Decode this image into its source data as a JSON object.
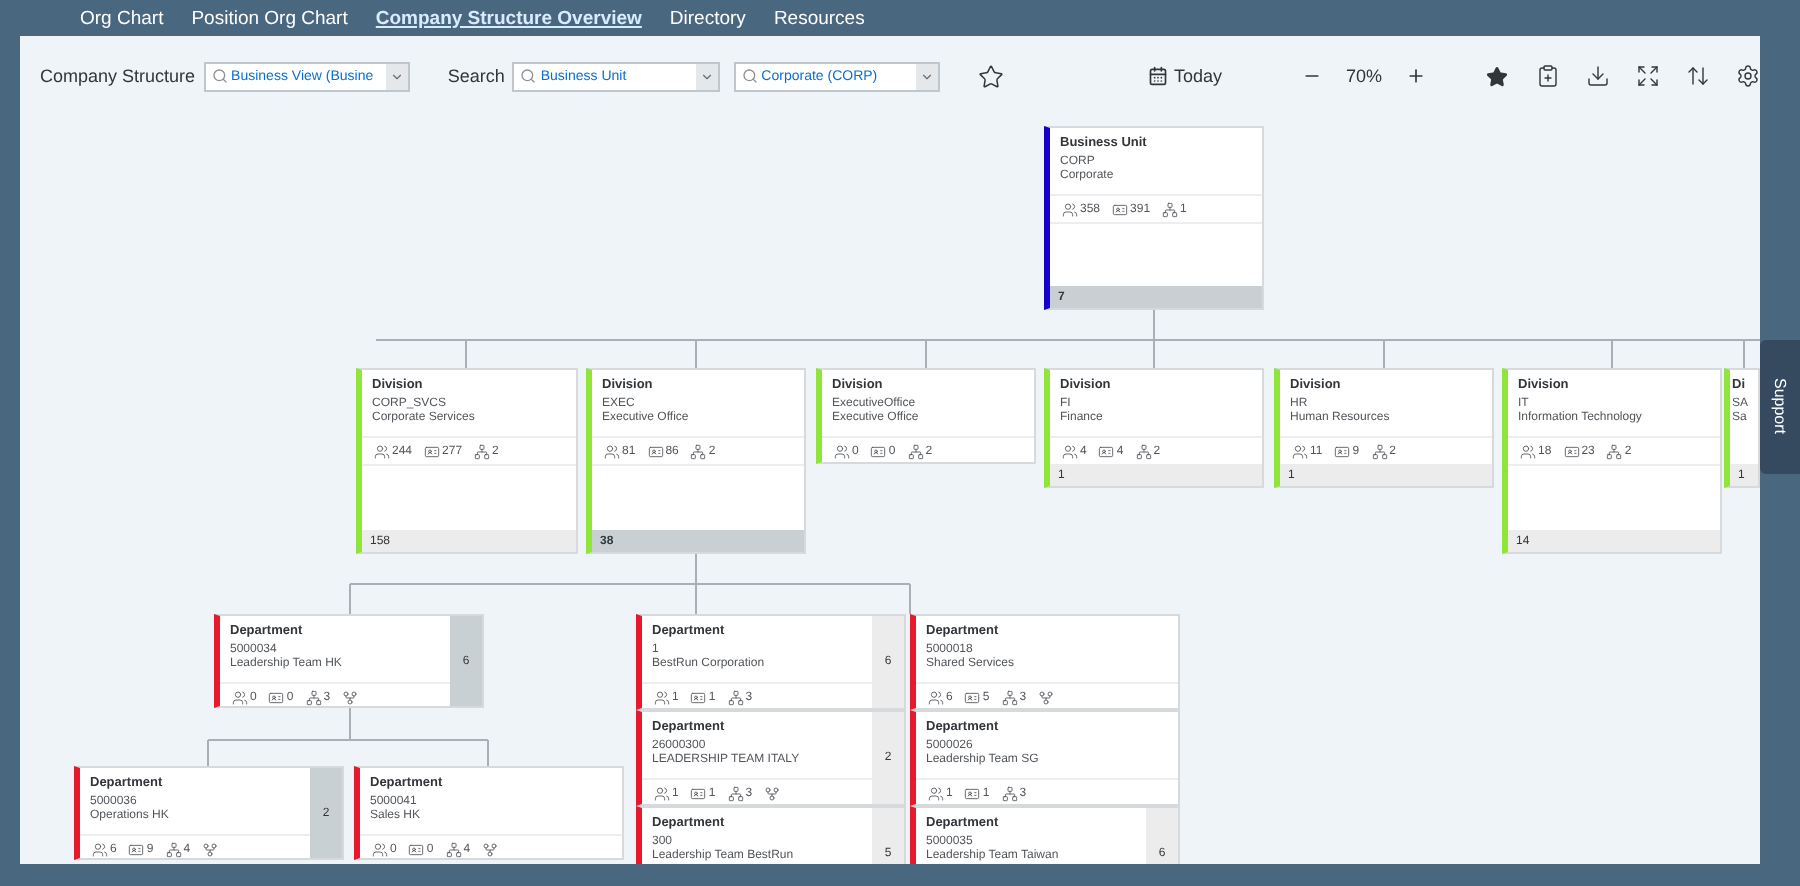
{
  "nav": [
    {
      "label": "Org Chart",
      "selected": false
    },
    {
      "label": "Position Org Chart",
      "selected": false
    },
    {
      "label": "Company Structure Overview",
      "selected": true
    },
    {
      "label": "Directory",
      "selected": false
    },
    {
      "label": "Resources",
      "selected": false
    }
  ],
  "toolbar": {
    "structure_label": "Company Structure",
    "structure_value": "Business View (Busine",
    "search_label": "Search",
    "search_type": "Business Unit",
    "search_value": "Corporate (CORP)",
    "today": "Today",
    "zoom": "70%"
  },
  "nodes": [
    {
      "kind": "business-unit",
      "type": "Business Unit",
      "code": "CORP",
      "name": "Corporate",
      "employees": "358",
      "positions": "391",
      "units": "1",
      "footer": "7",
      "expanded": true
    },
    {
      "kind": "division",
      "type": "Division",
      "code": "CORP_SVCS",
      "name": "Corporate Services",
      "employees": "244",
      "positions": "277",
      "units": "2",
      "footer": "158",
      "expanded": false
    },
    {
      "kind": "division",
      "type": "Division",
      "code": "EXEC",
      "name": "Executive Office",
      "employees": "81",
      "positions": "86",
      "units": "2",
      "footer": "38",
      "expanded": true
    },
    {
      "kind": "division",
      "type": "Division",
      "code": "ExecutiveOffice",
      "name": "Executive Office",
      "employees": "0",
      "positions": "0",
      "units": "2"
    },
    {
      "kind": "division",
      "type": "Division",
      "code": "FI",
      "name": "Finance",
      "employees": "4",
      "positions": "4",
      "units": "2",
      "footer": "1",
      "expanded": false
    },
    {
      "kind": "division",
      "type": "Division",
      "code": "HR",
      "name": "Human Resources",
      "employees": "11",
      "positions": "9",
      "units": "2",
      "footer": "1",
      "expanded": false
    },
    {
      "kind": "division",
      "type": "Division",
      "code": "IT",
      "name": "Information Technology",
      "employees": "18",
      "positions": "23",
      "units": "2",
      "footer": "14",
      "expanded": false
    },
    {
      "kind": "division",
      "type": "Di",
      "code": "SA",
      "name": "Sa",
      "footer": "1",
      "expanded": false
    },
    {
      "kind": "department",
      "type": "Department",
      "code": "5000034",
      "name": "Leadership Team HK",
      "employees": "0",
      "positions": "0",
      "units": "3",
      "has_relations": true,
      "count": "6",
      "expanded": true
    },
    {
      "kind": "department",
      "type": "Department",
      "code": "5000036",
      "name": "Operations HK",
      "employees": "6",
      "positions": "9",
      "units": "4",
      "has_relations": true,
      "count": "2",
      "expanded": true
    },
    {
      "kind": "department",
      "type": "Department",
      "code": "5000041",
      "name": "Sales HK",
      "employees": "0",
      "positions": "0",
      "units": "4",
      "has_relations": true
    },
    {
      "kind": "department",
      "type": "Department",
      "code": "1",
      "name": "BestRun Corporation",
      "employees": "1",
      "positions": "1",
      "units": "3",
      "has_relations": false,
      "count": "6",
      "expanded": false
    },
    {
      "kind": "department",
      "type": "Department",
      "code": "26000300",
      "name": "LEADERSHIP TEAM ITALY",
      "employees": "1",
      "positions": "1",
      "units": "3",
      "has_relations": true,
      "count": "2",
      "expanded": false
    },
    {
      "kind": "department",
      "type": "Department",
      "code": "300",
      "name": "Leadership Team BestRun",
      "count": "5",
      "expanded": false
    },
    {
      "kind": "department",
      "type": "Department",
      "code": "5000018",
      "name": "Shared Services",
      "employees": "6",
      "positions": "5",
      "units": "3",
      "has_relations": true
    },
    {
      "kind": "department",
      "type": "Department",
      "code": "5000026",
      "name": "Leadership Team SG",
      "employees": "1",
      "positions": "1",
      "units": "3",
      "has_relations": false
    },
    {
      "kind": "department",
      "type": "Department",
      "code": "5000035",
      "name": "Leadership Team Taiwan",
      "count": "6",
      "expanded": false
    }
  ],
  "support": "Support"
}
